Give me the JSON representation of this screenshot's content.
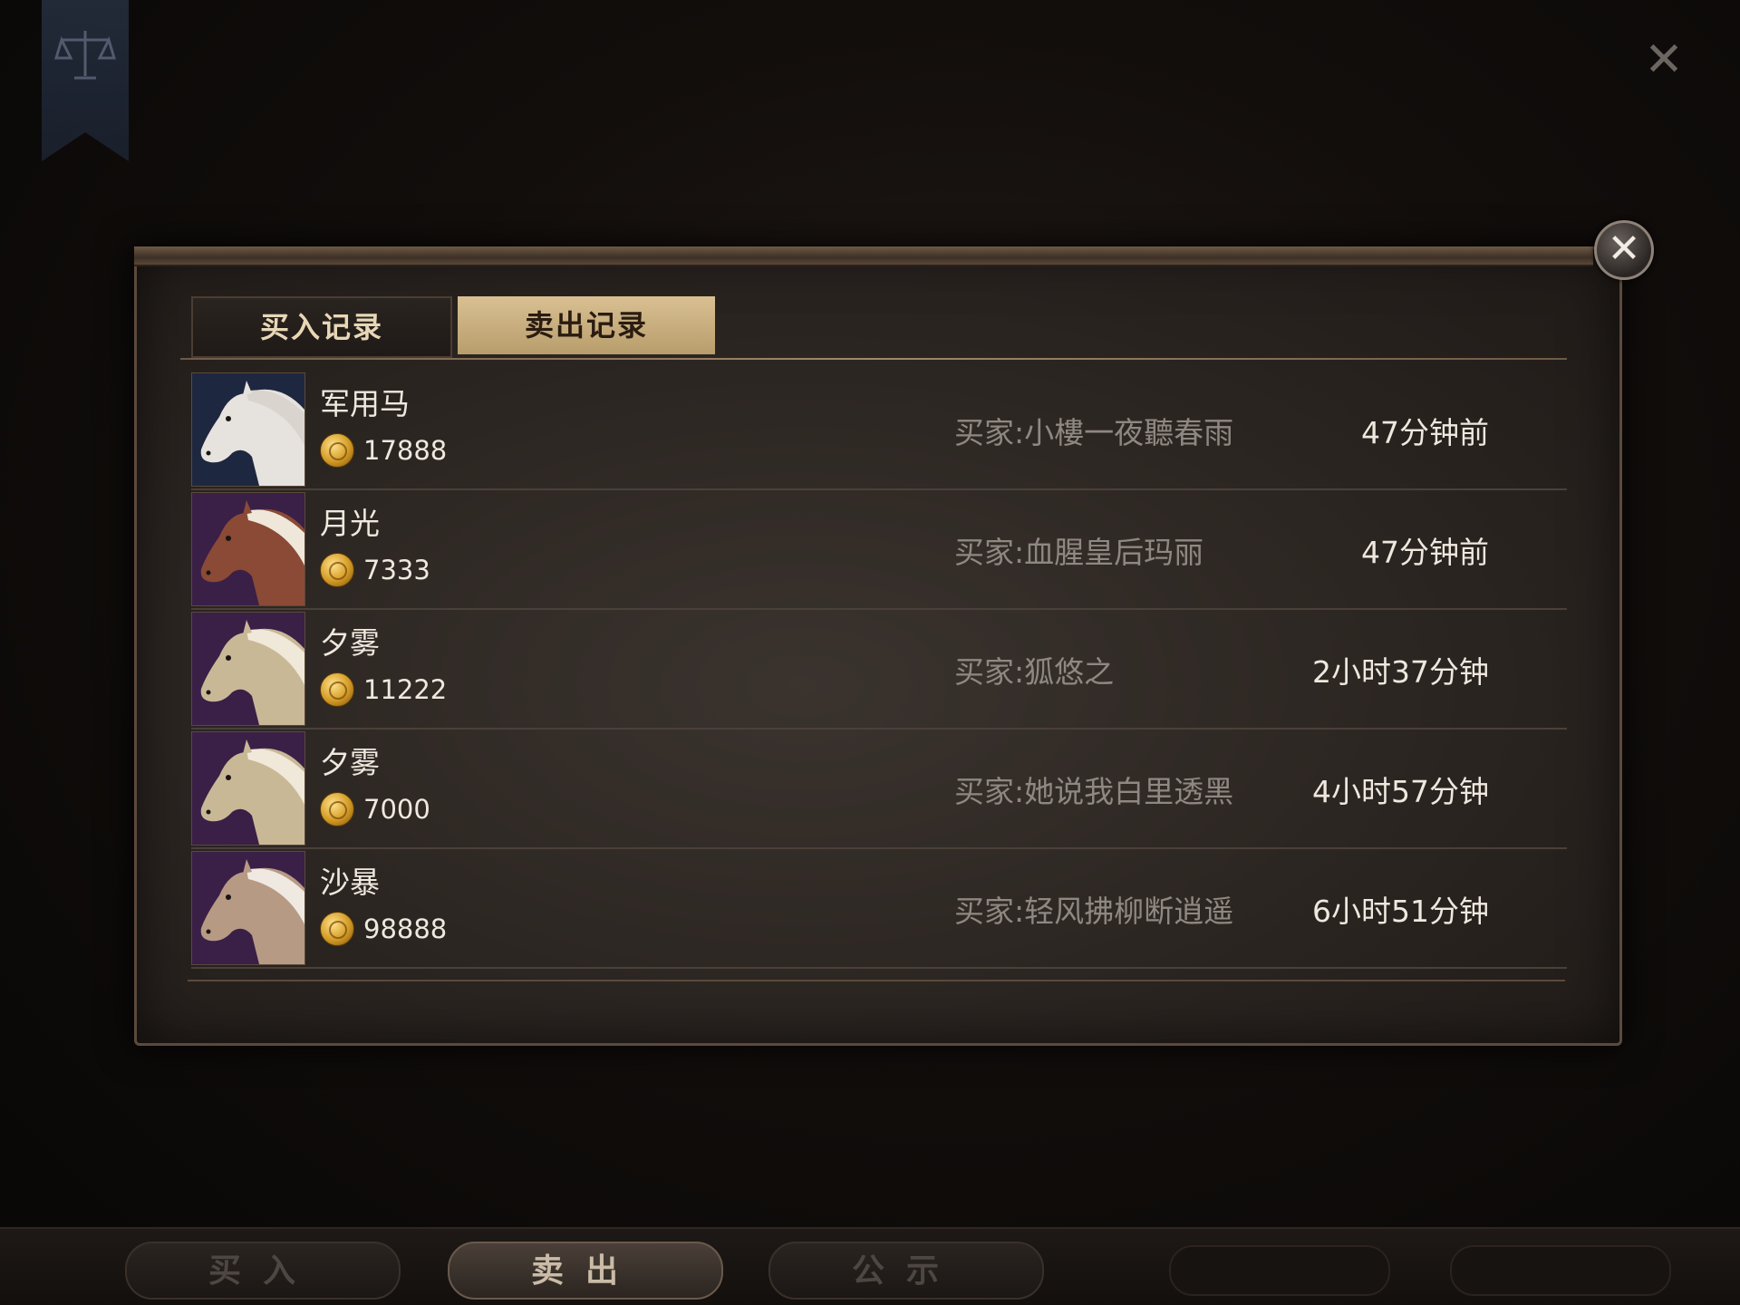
{
  "window": {
    "close_glyph": "✕"
  },
  "banner": {
    "icon": "scales-icon"
  },
  "dialog": {
    "close_glyph": "✕"
  },
  "tabs": [
    {
      "label": "买入记录",
      "active": false
    },
    {
      "label": "卖出记录",
      "active": true
    }
  ],
  "records": [
    {
      "name": "军用马",
      "price": "17888",
      "buyer": "买家:小樓一夜聽春雨",
      "time": "47分钟前",
      "portrait": {
        "bg": "#1e2740",
        "coat": "#e6e2dd",
        "mane": "#d9d4ce"
      }
    },
    {
      "name": "月光",
      "price": "7333",
      "buyer": "买家:血腥皇后玛丽",
      "time": "47分钟前",
      "portrait": {
        "bg": "#3a1f47",
        "coat": "#8a4a35",
        "mane": "#efe7d9"
      }
    },
    {
      "name": "夕雾",
      "price": "11222",
      "buyer": "买家:狐悠之",
      "time": "2小时37分钟",
      "portrait": {
        "bg": "#3a1f47",
        "coat": "#c9b896",
        "mane": "#f0e8d8"
      }
    },
    {
      "name": "夕雾",
      "price": "7000",
      "buyer": "买家:她说我白里透黑",
      "time": "4小时57分钟",
      "portrait": {
        "bg": "#3a1f47",
        "coat": "#c9b896",
        "mane": "#f0e8d8"
      }
    },
    {
      "name": "沙暴",
      "price": "98888",
      "buyer": "买家:轻风拂柳断逍遥",
      "time": "6小时51分钟",
      "portrait": {
        "bg": "#3a1f47",
        "coat": "#b79a84",
        "mane": "#efe9e2"
      }
    }
  ],
  "bottom_nav": [
    {
      "label": "买入",
      "active": false
    },
    {
      "label": "卖出",
      "active": true
    },
    {
      "label": "公示",
      "active": false
    }
  ],
  "colors": {
    "accent_gold": "#d9c092",
    "text_light": "#efe8df",
    "text_muted": "#8f8882",
    "coin": "#d29a24"
  }
}
